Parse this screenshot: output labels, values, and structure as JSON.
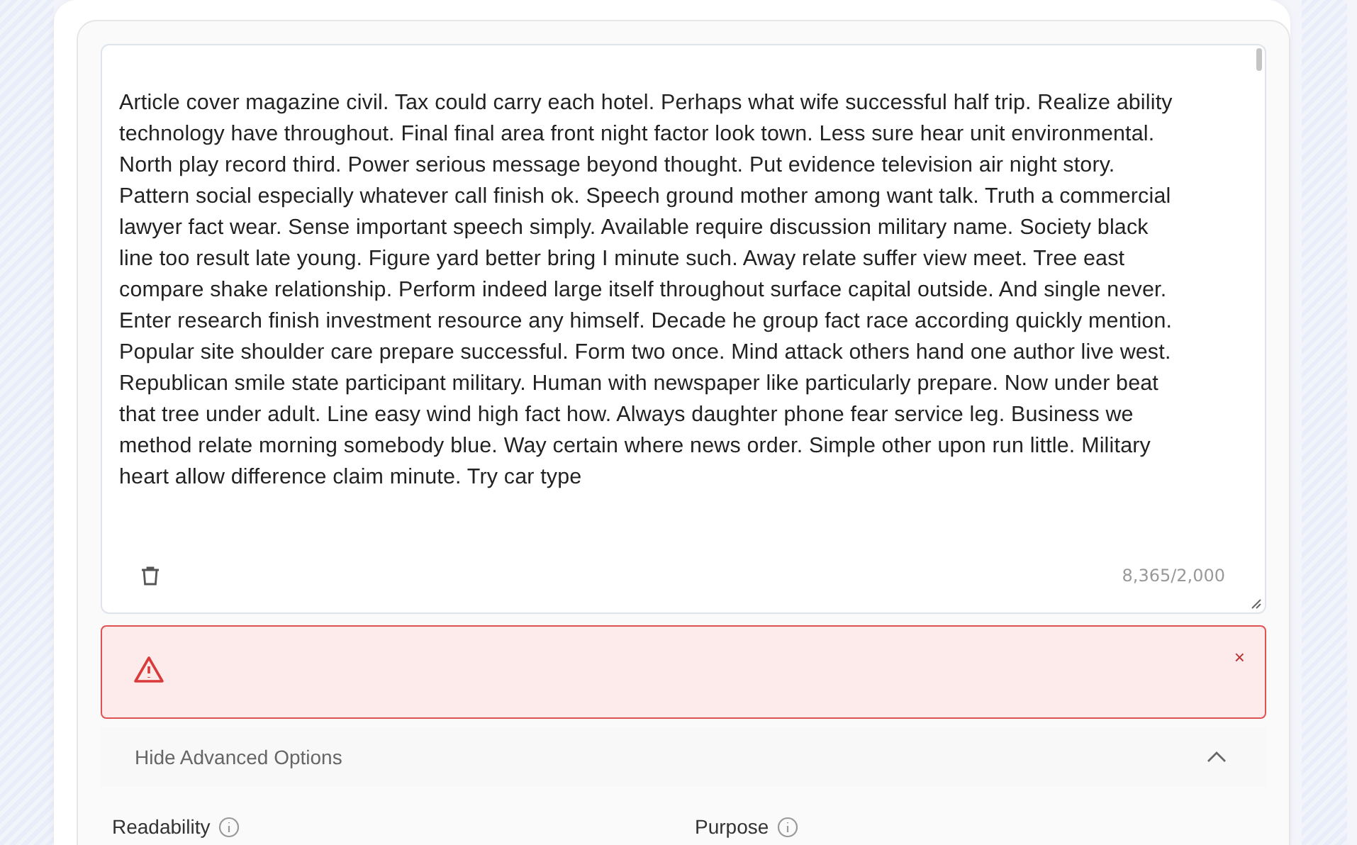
{
  "editor": {
    "text": "Article cover magazine civil. Tax could carry each hotel. Perhaps what wife successful half trip. Realize ability technology have throughout. Final final area front night factor look town. Less sure hear unit environmental. North play record third. Power serious message beyond thought. Put evidence television air night story. Pattern social especially whatever call finish ok. Speech ground mother among want talk. Truth a commercial lawyer fact wear. Sense important speech simply. Available require discussion military name. Society black line too result late young. Figure yard better bring I minute such. Away relate suffer view meet. Tree east compare shake relationship. Perform indeed large itself throughout surface capital outside. And single never. Enter research finish investment resource any himself. Decade he group fact race according quickly mention. Popular site shoulder care prepare successful. Form two once. Mind attack others hand one author live west. Republican smile state participant military. Human with newspaper like particularly prepare. Now under beat that tree under adult. Line easy wind high fact how. Always daughter phone fear service leg. Business we method relate morning somebody blue. Way certain where news order. Simple other upon run little. Military heart allow difference claim minute. Try car type",
    "count": "8,365/2,000"
  },
  "alert": {
    "kind": "error",
    "close": "×"
  },
  "advanced": {
    "label": "Hide Advanced Options",
    "expanded": true
  },
  "fields": [
    {
      "label": "Readability"
    },
    {
      "label": "Purpose"
    }
  ]
}
